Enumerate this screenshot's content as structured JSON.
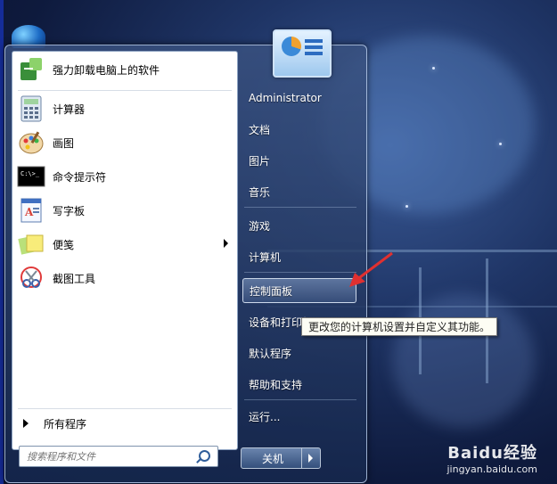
{
  "start_menu": {
    "programs": [
      {
        "label": "强力卸载电脑上的软件",
        "icon": "uninstall-icon"
      },
      {
        "label": "计算器",
        "icon": "calculator-icon"
      },
      {
        "label": "画图",
        "icon": "paint-icon"
      },
      {
        "label": "命令提示符",
        "icon": "command-prompt-icon"
      },
      {
        "label": "写字板",
        "icon": "wordpad-icon"
      },
      {
        "label": "便笺",
        "icon": "sticky-notes-icon",
        "has_submenu": true
      },
      {
        "label": "截图工具",
        "icon": "snipping-tool-icon"
      }
    ],
    "all_programs_label": "所有程序",
    "search": {
      "placeholder": "搜索程序和文件"
    },
    "right_items": [
      {
        "label": "Administrator"
      },
      {
        "label": "文档"
      },
      {
        "label": "图片"
      },
      {
        "label": "音乐"
      },
      {
        "label": "游戏"
      },
      {
        "label": "计算机"
      },
      {
        "label": "控制面板",
        "highlighted": true
      },
      {
        "label": "设备和打印机"
      },
      {
        "label": "默认程序"
      },
      {
        "label": "帮助和支持"
      },
      {
        "label": "运行..."
      }
    ],
    "shutdown_label": "关机"
  },
  "tooltip": {
    "text": "更改您的计算机设置并自定义其功能。"
  },
  "watermark": {
    "brand": "Baidu经验",
    "url": "jingyan.baidu.com"
  },
  "colors": {
    "accent_arrow": "#e03030",
    "menu_bg": "#2a4170",
    "highlight": "#7f98c2"
  }
}
